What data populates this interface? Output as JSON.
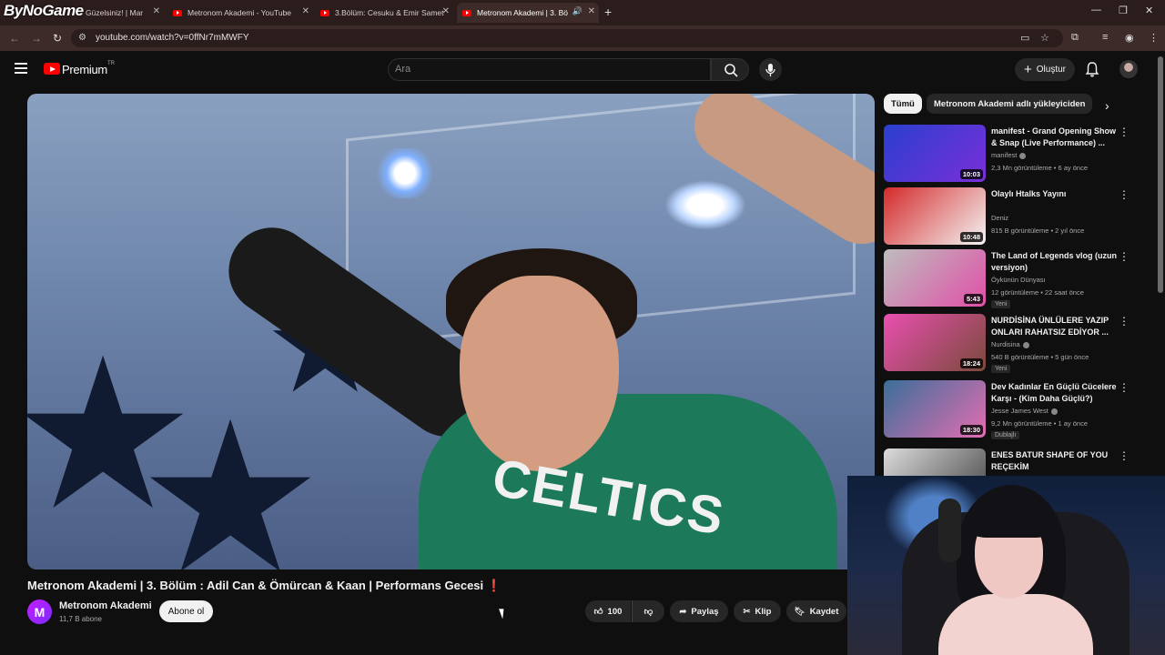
{
  "watermark": "ByNoGame",
  "browser": {
    "tabs": [
      {
        "title": "Güzelsiniz! | Mar"
      },
      {
        "title": "Metronom Akademi - YouTube"
      },
      {
        "title": "3.Bölüm: Cesuku & Emir Samet"
      },
      {
        "title": "Metronom Akademi | 3. Bö"
      }
    ],
    "url": "youtube.com/watch?v=0ffNr7mMWFY"
  },
  "header": {
    "logo_text": "Premium",
    "region": "TR",
    "search_placeholder": "Ara",
    "create_label": "Oluştur"
  },
  "video": {
    "title": "Metronom Akademi | 3. Bölüm : Adil Can & Ömürcan & Kaan | Performans Gecesi",
    "title_mark": "❗",
    "jersey_text": "CELTICS"
  },
  "channel": {
    "avatar_letter": "M",
    "name": "Metronom Akademi",
    "subscribers": "11,7 B abone",
    "subscribe_label": "Abone ol"
  },
  "actions": {
    "likes": "100",
    "share": "Paylaş",
    "clip": "Klip",
    "save": "Kaydet"
  },
  "sidebar": {
    "chips": [
      "Tümü",
      "Metronom Akademi adlı yükleyiciden"
    ],
    "recommendations": [
      {
        "title": "manifest - Grand Opening Show & Snap (Live Performance) ...",
        "channel": "manifest",
        "verified": true,
        "meta": "2,3 Mn görüntüleme • 6 ay önce",
        "duration": "10:03",
        "badge": "",
        "thumb": [
          "#2a3fcf",
          "#7a2fd8"
        ]
      },
      {
        "title": "Olaylı Htalks Yayını",
        "channel": "Deniz",
        "verified": false,
        "meta": "815 B görüntüleme • 2 yıl önce",
        "duration": "10:48",
        "badge": "",
        "thumb": [
          "#d42a2a",
          "#f4f4f4"
        ]
      },
      {
        "title": "The Land of Legends vlog (uzun versiyon)",
        "channel": "Öykünün Dünyası",
        "verified": false,
        "meta": "12 görüntüleme • 22 saat önce",
        "duration": "5:43",
        "badge": "Yeni",
        "thumb": [
          "#bdbdbd",
          "#e14fa8"
        ]
      },
      {
        "title": "NURDİSİNA ÜNLÜLERE YAZIP ONLARI RAHATSIZ EDİYOR ...",
        "channel": "Nurdisina",
        "verified": true,
        "meta": "540 B görüntüleme • 5 gün önce",
        "duration": "18:24",
        "badge": "Yeni",
        "thumb": [
          "#e94fb0",
          "#7a4a3a"
        ]
      },
      {
        "title": "Dev Kadınlar En Güçlü Cücelere Karşı - (Kim Daha Güçlü?)",
        "channel": "Jesse James West",
        "verified": true,
        "meta": "9,2 Mn görüntüleme • 1 ay önce",
        "duration": "18:30",
        "badge": "Dublajlı",
        "thumb": [
          "#3a6f9a",
          "#e36db0"
        ]
      },
      {
        "title": "ENES BATUR SHAPE OF YOU REÇEKİM",
        "channel": "",
        "verified": false,
        "meta": "",
        "duration": "",
        "badge": "",
        "thumb": [
          "#dcdcdc",
          "#444444"
        ]
      }
    ]
  },
  "colors": {
    "accent_red": "#ff0000",
    "background": "#0f0f0f"
  }
}
